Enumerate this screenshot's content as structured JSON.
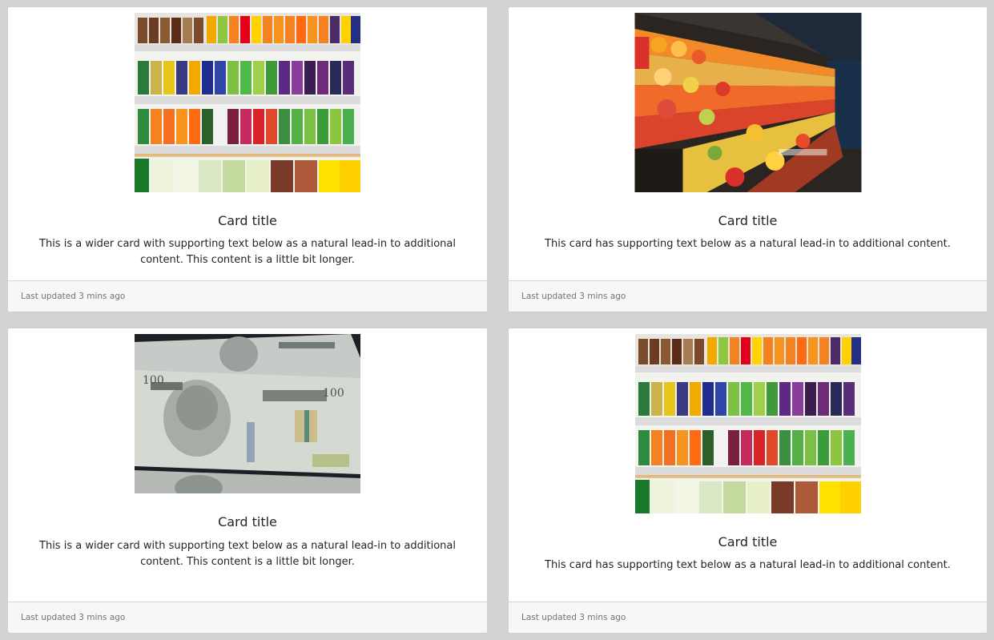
{
  "cards": [
    {
      "image": "soda-shelf",
      "title": "Card title",
      "text": "This is a wider card with supporting text below as a natural lead-in to additional content. This content is a little bit longer.",
      "footer": "Last updated 3 mins ago"
    },
    {
      "image": "produce-aisle",
      "title": "Card title",
      "text": "This card has supporting text below as a natural lead-in to additional content.",
      "footer": "Last updated 3 mins ago"
    },
    {
      "image": "dollar-bills",
      "title": "Card title",
      "text": "This is a wider card with supporting text below as a natural lead-in to additional content. This content is a little bit longer.",
      "footer": "Last updated 3 mins ago"
    },
    {
      "image": "soda-shelf",
      "title": "Card title",
      "text": "This card has supporting text below as a natural lead-in to additional content.",
      "footer": "Last updated 3 mins ago"
    }
  ]
}
